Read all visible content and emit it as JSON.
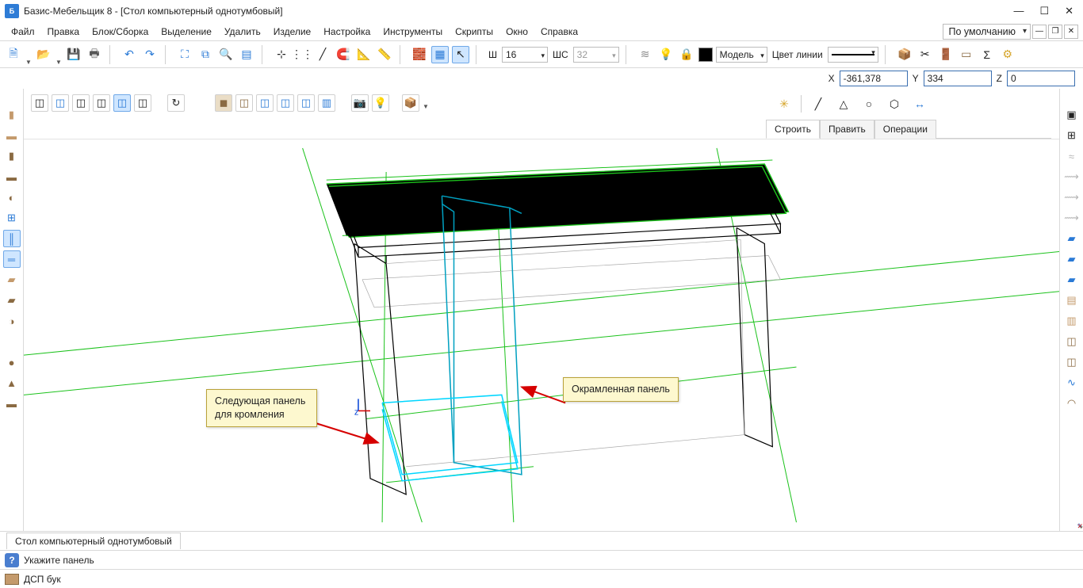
{
  "title": "Базис-Мебельщик 8 - [Стол компьютерный однотумбовый]",
  "menus": [
    "Файл",
    "Правка",
    "Блок/Сборка",
    "Выделение",
    "Удалить",
    "Изделие",
    "Настройка",
    "Инструменты",
    "Скрипты",
    "Окно",
    "Справка"
  ],
  "default_combo": "По умолчанию",
  "toolbar": {
    "w_label": "Ш",
    "w_value": "16",
    "ws_label": "ШС",
    "ws_value": "32",
    "model_label": "Модель",
    "linecolor_label": "Цвет линии"
  },
  "coords": {
    "x_label": "X",
    "x": "-361,378",
    "y_label": "Y",
    "y": "334",
    "z_label": "Z",
    "z": "0"
  },
  "edit_panel": {
    "tabs": [
      "Строить",
      "Править",
      "Операции"
    ],
    "active": 0
  },
  "callouts": {
    "left": "Следующая панель для кромления",
    "right": "Окрамленная панель"
  },
  "doc_tab": "Стол компьютерный однотумбовый",
  "status_prompt": "Укажите панель",
  "material": "ДСП бук"
}
